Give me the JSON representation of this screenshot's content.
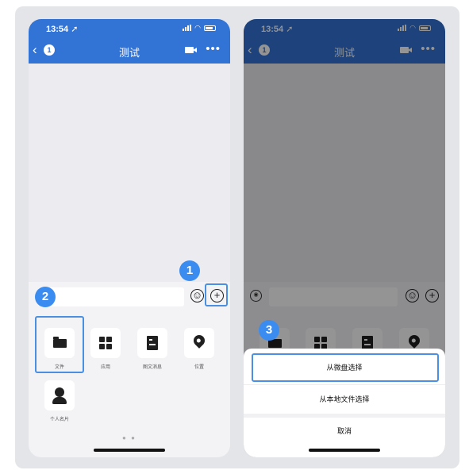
{
  "status_bar": {
    "time": "13:54 ➚"
  },
  "nav": {
    "back_glyph": "‹",
    "badge_count": "1",
    "title": "测试",
    "more_glyph": "•••"
  },
  "input_bar": {
    "voice_glyph": "◉",
    "emoji_glyph": "☺",
    "plus_glyph": "+"
  },
  "attach_panel": {
    "items": [
      {
        "label": "文件",
        "icon": "folder-icon"
      },
      {
        "label": "应用",
        "icon": "apps-grid-icon"
      },
      {
        "label": "图文消息",
        "icon": "document-icon"
      },
      {
        "label": "位置",
        "icon": "location-pin-icon"
      },
      {
        "label": "个人名片",
        "icon": "contact-card-icon"
      }
    ],
    "page_dots": "● ●"
  },
  "action_sheet": {
    "options": [
      "从微盘选择",
      "从本地文件选择"
    ],
    "cancel": "取消"
  },
  "callouts": [
    "1",
    "2",
    "3"
  ],
  "colors": {
    "nav_blue": "#3273d6",
    "highlight_blue": "#4a90e2",
    "callout_blue": "#3b8cf0"
  }
}
